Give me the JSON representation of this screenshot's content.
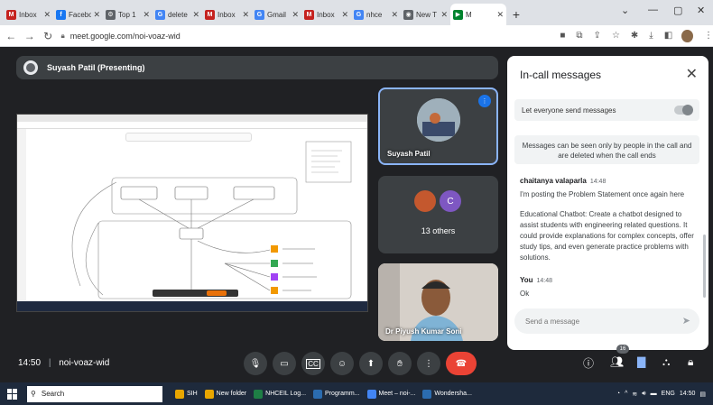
{
  "browser": {
    "tabs": [
      {
        "label": "Inbox",
        "icon": "gmail-icon",
        "color": "#c5221f",
        "glyph": "M"
      },
      {
        "label": "Facebook",
        "icon": "facebook-icon",
        "color": "#1877f2",
        "glyph": "f"
      },
      {
        "label": "Top 1",
        "icon": "gear-icon",
        "color": "#5f6368",
        "glyph": "⚙"
      },
      {
        "label": "delete",
        "icon": "google-icon",
        "color": "#4285f4",
        "glyph": "G"
      },
      {
        "label": "Inbox",
        "icon": "gmail-icon",
        "color": "#c5221f",
        "glyph": "M"
      },
      {
        "label": "Gmail",
        "icon": "google-icon",
        "color": "#4285f4",
        "glyph": "G"
      },
      {
        "label": "Inbox",
        "icon": "gmail-icon",
        "color": "#c5221f",
        "glyph": "M"
      },
      {
        "label": "nhce",
        "icon": "google-icon",
        "color": "#4285f4",
        "glyph": "G"
      },
      {
        "label": "New T",
        "icon": "new-tab-icon",
        "color": "#5f6368",
        "glyph": "◉"
      },
      {
        "label": "M",
        "icon": "meet-icon",
        "color": "#00832d",
        "glyph": "▶",
        "active": true
      }
    ],
    "new_tab": "+",
    "url": "meet.google.com/noi-voaz-wid"
  },
  "meet": {
    "presenter_label": "Suyash Patil (Presenting)",
    "tiles": {
      "suyash": "Suyash Patil",
      "others_initial": "C",
      "others_count": "13 others",
      "piyush": "Dr Piyush Kumar Soni"
    },
    "shared_screen": {
      "diagram_title": "Study Flow / Workflow Diagram",
      "nodes": [
        "StudyBuddy AI",
        "Student Info",
        "Learning Path",
        "Chat UI",
        "Knowledge",
        "Personalized",
        "Progress",
        "Chat Bot"
      ]
    },
    "chat": {
      "title": "In-call messages",
      "toggle_label": "Let everyone send messages",
      "notice": "Messages can be seen only by people in the call and are deleted when the call ends",
      "messages": [
        {
          "sender": "chaitanya valaparla",
          "time": "14:48",
          "lines": [
            "I'm posting the Problem Statement once again here",
            "Educational Chatbot: Create a chatbot designed to assist students with engineering related questions. It could provide explanations for complex concepts, offer study tips, and even generate practice problems with solutions."
          ]
        },
        {
          "sender": "You",
          "time": "14:48",
          "lines": [
            "Ok"
          ]
        }
      ],
      "input_placeholder": "Send a message"
    },
    "bottom": {
      "time": "14:50",
      "separator": "|",
      "meeting_code": "noi-voaz-wid",
      "participant_badge": "16"
    }
  },
  "taskbar": {
    "search_label": "Search",
    "items": [
      {
        "label": "SIH",
        "color": "#e8a600"
      },
      {
        "label": "New folder",
        "color": "#e8a600"
      },
      {
        "label": "NHCEIL Log...",
        "color": "#1e7e45"
      },
      {
        "label": "Programm...",
        "color": "#2b6cb0"
      },
      {
        "label": "Meet – noi-...",
        "color": "#4285f4"
      },
      {
        "label": "Wondersha...",
        "color": "#2b6cb0"
      }
    ],
    "lang": "ENG",
    "clock": "14:50"
  }
}
